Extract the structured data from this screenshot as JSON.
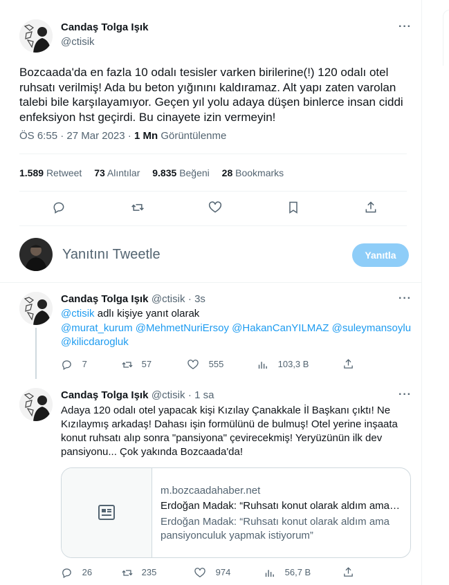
{
  "main_tweet": {
    "name": "Candaş Tolga Işık",
    "handle": "@ctisik",
    "text": "Bozcaada'da en fazla 10 odalı tesisler varken birilerine(!) 120 odalı otel ruhsatı verilmiş! Ada bu beton yığınını kaldıramaz. Alt yapı zaten varolan talebi bile karşılayamıyor. Geçen yıl yolu adaya düşen binlerce insan ciddi enfeksiyon hst geçirdi. Bu cinayete izin vermeyin!",
    "time": "ÖS 6:55",
    "date": "27 Mar 2023",
    "views_count": "1 Mn",
    "views_label": "Görüntülenme",
    "stats": {
      "retweets": "1.589",
      "retweets_label": "Retweet",
      "quotes": "73",
      "quotes_label": "Alıntılar",
      "likes": "9.835",
      "likes_label": "Beğeni",
      "bookmarks": "28",
      "bookmarks_label": "Bookmarks"
    }
  },
  "composer": {
    "placeholder": "Yanıtını Tweetle",
    "button": "Yanıtla"
  },
  "replies": [
    {
      "name": "Candaş Tolga Işık",
      "handle": "@ctisik",
      "time": "3s",
      "replying_handle": "@ctisik",
      "replying_suffix": "adlı kişiye yanıt olarak",
      "mentions": "@murat_kurum @MehmetNuriErsoy @HakanCanYILMAZ @suleymansoylu @kilicdarogluk",
      "replies": "7",
      "retweets": "57",
      "likes": "555",
      "views": "103,3 B"
    },
    {
      "name": "Candaş Tolga Işık",
      "handle": "@ctisik",
      "time": "1 sa",
      "text": "Adaya 120 odalı otel yapacak kişi Kızılay Çanakkale İl Başkanı çıktı! Ne Kızılaymış arkadaş! Dahası işin formülünü de bulmuş! Otel yerine inşaata konut ruhsatı alıp sonra \"pansiyona\" çevirecekmiş! Yeryüzünün ilk dev pansiyonu... Çok yakında Bozcaada'da!",
      "card": {
        "domain": "m.bozcaadahaber.net",
        "title": "Erdoğan Madak: “Ruhsatı konut olarak aldım ama…",
        "description": "Erdoğan Madak: “Ruhsatı konut olarak aldım ama pansiyonculuk yapmak istiyorum”"
      },
      "replies": "26",
      "retweets": "235",
      "likes": "974",
      "views": "56,7 B"
    }
  ]
}
